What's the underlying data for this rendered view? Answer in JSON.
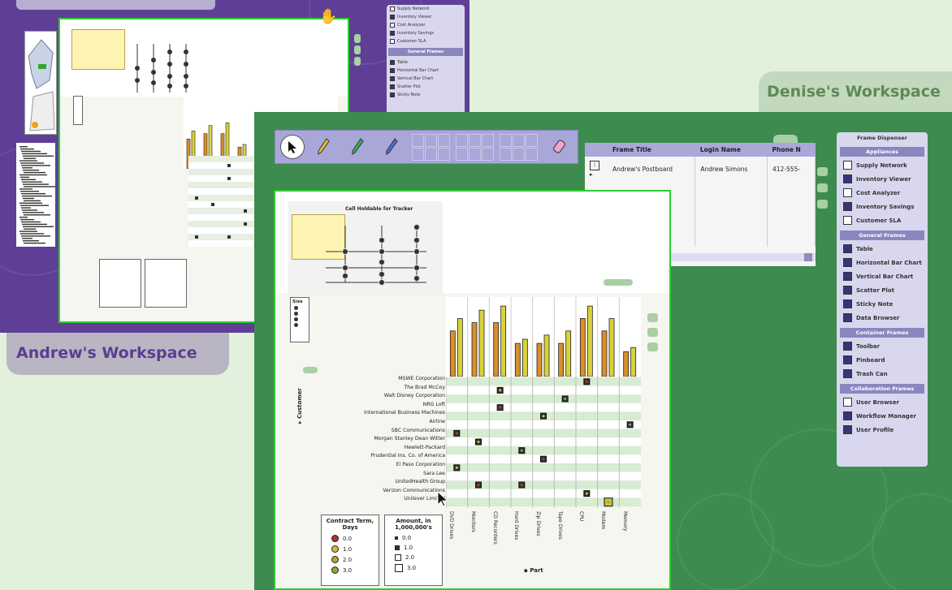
{
  "workspaces": {
    "andrew": {
      "label": "Andrew's Workspace"
    },
    "denise": {
      "label": "Denise's Workspace"
    }
  },
  "toolbar": {
    "tools": [
      "pointer-tool",
      "yellow-pen-tool",
      "green-pen-tool",
      "blue-pen-tool",
      "eraser-tool"
    ]
  },
  "table_frame": {
    "headers": [
      "Frame Title",
      "Login Name",
      "Phone N"
    ],
    "rows": [
      {
        "frame_title": "Andrew's Postboard",
        "login_name": "Andrew Simons",
        "phone": "412-555-"
      }
    ]
  },
  "dispenser": {
    "title": "Frame Dispenser",
    "sections": [
      {
        "name": "Appliances",
        "items": [
          {
            "label": "Supply Network",
            "checked": false
          },
          {
            "label": "Inventory Viewer",
            "checked": true
          },
          {
            "label": "Cost Analyzer",
            "checked": false
          },
          {
            "label": "Inventory Savings",
            "checked": true
          },
          {
            "label": "Customer SLA",
            "checked": false
          }
        ]
      },
      {
        "name": "General Frames",
        "items": [
          {
            "label": "Table",
            "checked": true
          },
          {
            "label": "Horizontal Bar Chart",
            "checked": true
          },
          {
            "label": "Vertical Bar Chart",
            "checked": true
          },
          {
            "label": "Scatter Plot",
            "checked": true
          },
          {
            "label": "Sticky Note",
            "checked": true
          },
          {
            "label": "Data Browser",
            "checked": true
          }
        ]
      },
      {
        "name": "Container Frames",
        "items": [
          {
            "label": "Toolbar",
            "checked": true
          },
          {
            "label": "Pinboard",
            "checked": true
          },
          {
            "label": "Trash Can",
            "checked": true
          }
        ]
      },
      {
        "name": "Collaboration Frames",
        "items": [
          {
            "label": "User Browser",
            "checked": false
          },
          {
            "label": "Workflow Manager",
            "checked": true
          },
          {
            "label": "User Profile",
            "checked": true
          }
        ]
      }
    ]
  },
  "andrew_dispenser": {
    "items": [
      "Supply Network",
      "Inventory Viewer",
      "Cost Analyzer",
      "Inventory Savings",
      "Customer SLA"
    ],
    "section2": "General Frames",
    "items2": [
      "Table",
      "Horizontal Bar Chart",
      "Vertical Bar Chart",
      "Scatter Plot",
      "Sticky Note"
    ]
  },
  "matrix": {
    "sticky_title": "Cell Holdable for Tracker",
    "mini_legend_title": "Size",
    "customers": [
      "MSWE Corporation",
      "The Brad McCoy",
      "Walt Disney Corporation",
      "NRG Loft",
      "International Business Machines",
      "Airline",
      "SBC Communications",
      "Morgan Stanley Dean Witter",
      "Hewlett-Packard",
      "Prudential Ins. Co. of America",
      "El Paso Corporation",
      "Sara Lee",
      "UnitedHealth Group",
      "Verizon Communications",
      "Unilever Limited"
    ],
    "parts": [
      "DVD Drives",
      "Monitors",
      "CD Recorders",
      "Hard Drives",
      "Zip Drives",
      "Tape Drives",
      "CPU",
      "Modem",
      "Memory"
    ],
    "y_axis_label": "Customer",
    "x_axis_label": "Part",
    "bars": [
      [
        55,
        70
      ],
      [
        65,
        80
      ],
      [
        65,
        85
      ],
      [
        40,
        45
      ],
      [
        40,
        50
      ],
      [
        40,
        55
      ],
      [
        70,
        85
      ],
      [
        55,
        70
      ],
      [
        30,
        35
      ]
    ],
    "contract_legend": {
      "title": "Contract Term, Days",
      "items": [
        "0.0",
        "1.0",
        "2.0",
        "3.0"
      ]
    },
    "amount_legend": {
      "title": "Amount, in 1,000,000's",
      "items": [
        "0.0",
        "1.0",
        "2.0",
        "3.0"
      ]
    }
  },
  "colors": {
    "andrew_workspace": "#5f3f96",
    "denise_workspace": "#3e8b4f",
    "window_border": "#2ecc2e",
    "panel": "#e6e4f4",
    "bar_yellow": "#d9d33a",
    "bar_orange": "#d8902a"
  }
}
